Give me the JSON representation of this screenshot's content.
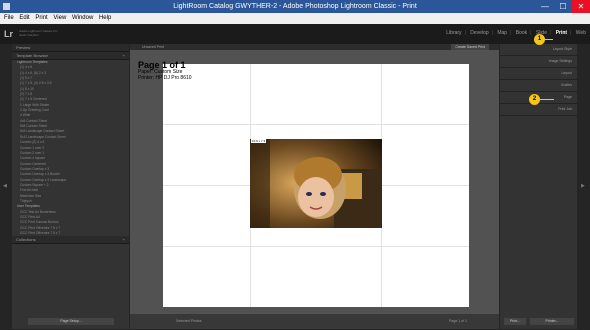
{
  "window": {
    "title": "LightRoom Catalog GWYTHER-2 - Adobe Photoshop Lightroom Classic - Print",
    "minimize": "—",
    "maximize": "☐",
    "close": "✕"
  },
  "menu": [
    "File",
    "Edit",
    "Print",
    "View",
    "Window",
    "Help"
  ],
  "identity": {
    "logo": "Lr",
    "catalog_line1": "Adobe Lightroom Classic CC",
    "catalog_line2": "Justin Gwyther"
  },
  "modules": [
    "Library",
    "Develop",
    "Map",
    "Book",
    "Slide",
    "Print",
    "Web"
  ],
  "active_module": "Print",
  "left_panel": {
    "preview_label": "Preview",
    "template_browser_label": "Template Browser",
    "templates": [
      {
        "label": "Lightroom Templates",
        "folder": true
      },
      {
        "label": "(1) 4 x 6"
      },
      {
        "label": "(1) 4 x 6, (6) 2 x 3"
      },
      {
        "label": "(1) 5 x 7"
      },
      {
        "label": "(1) 7 x 5, (4) 2.5 x 3.5"
      },
      {
        "label": "(1) 8 x 10"
      },
      {
        "label": "(2) 7 x 5"
      },
      {
        "label": "(2) 7 x 5 Centered"
      },
      {
        "label": "1 Large With Stroke"
      },
      {
        "label": "2-Up Greeting Card"
      },
      {
        "label": "4 Wide"
      },
      {
        "label": "4x5 Contact Sheet"
      },
      {
        "label": "5x8 Contact Sheet"
      },
      {
        "label": "5x9 Landscape Contact Sheet"
      },
      {
        "label": "5x11 Landscape Contact Sheet"
      },
      {
        "label": "Custom (2) 4 x 6"
      },
      {
        "label": "Custom 1 over 2"
      },
      {
        "label": "Custom 2 over 1"
      },
      {
        "label": "Custom 4 square"
      },
      {
        "label": "Custom Centered"
      },
      {
        "label": "Custom Overlap x 3"
      },
      {
        "label": "Custom Overlap x 3 Border"
      },
      {
        "label": "Custom Overlap x 3 Landscape"
      },
      {
        "label": "Custom Square + 2"
      },
      {
        "label": "Fine Art Mat"
      },
      {
        "label": "Maximize Size"
      },
      {
        "label": "Triptych"
      },
      {
        "label": "User Templates",
        "folder": true
      },
      {
        "label": "GCC Test A4 Borderless"
      },
      {
        "label": "GCC Print A4"
      },
      {
        "label": "GCC Print Canvas Borrow"
      },
      {
        "label": "GCC Print Offcentre 7 5 x 7"
      },
      {
        "label": "GCC Print Offcentre 7 5 x 7"
      }
    ],
    "collections_label": "Collections",
    "page_setup_button": "Page Setup..."
  },
  "center": {
    "header_label": "Unsaved Print",
    "create_button": "Create Saved Print",
    "page_title": "Page 1 of 1",
    "paper": "Paper: Custom Size",
    "printer": "Printer: HP DJ Pro 8610",
    "photo_label": "10.9 x 7.3",
    "toolbar_use": "Selected Photos",
    "toolbar_page": "Page 1 of 1"
  },
  "right_panel": {
    "sections": [
      "Layout Style",
      "Image Settings",
      "Layout",
      "Guides",
      "Page",
      "Print Job"
    ],
    "print_button": "Print...",
    "printer_button": "Printer..."
  },
  "callouts": [
    "1",
    "2"
  ],
  "colors": {
    "callout": "#f5c518",
    "titlebar": "#2b579a"
  }
}
